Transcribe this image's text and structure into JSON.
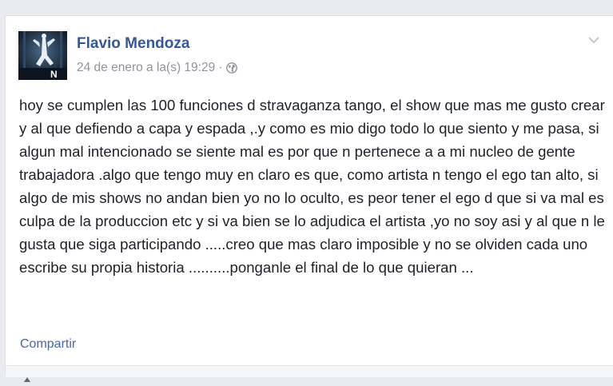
{
  "post": {
    "author": "Flavio Mendoza",
    "timestamp": "24 de enero a la(s) 19:29",
    "separator": "·",
    "privacy_icon": "globe-icon",
    "menu_icon": "chevron-down-icon",
    "text": "hoy se cumplen las 100 funciones d stravaganza tango, el show que mas me gusto crear y al que defiendo a capa y espada ,.y como es mio digo todo lo que siento y me pasa, si algun mal intencionado se siente mal es por que n pertenece a a mi nucleo de gente trabajadora .algo que tengo muy en claro es que, como artista n tengo el ego tan alto, si algo de mis shows no andan bien yo no lo oculto, es peor tener el ego d que si va mal es culpa de la produccion etc y si va bien se lo adjudica el artista ,yo no soy asi y al que n le gusta que siga participando .....creo que mas claro imposible y no se olviden cada uno escribe su propia historia ..........ponganle el final de lo que quieran ...",
    "share_label": "Compartir"
  },
  "colors": {
    "link": "#365899",
    "meta": "#90949c",
    "text": "#1d2129",
    "share": "#4b67a1",
    "background": "#e9ebee"
  }
}
